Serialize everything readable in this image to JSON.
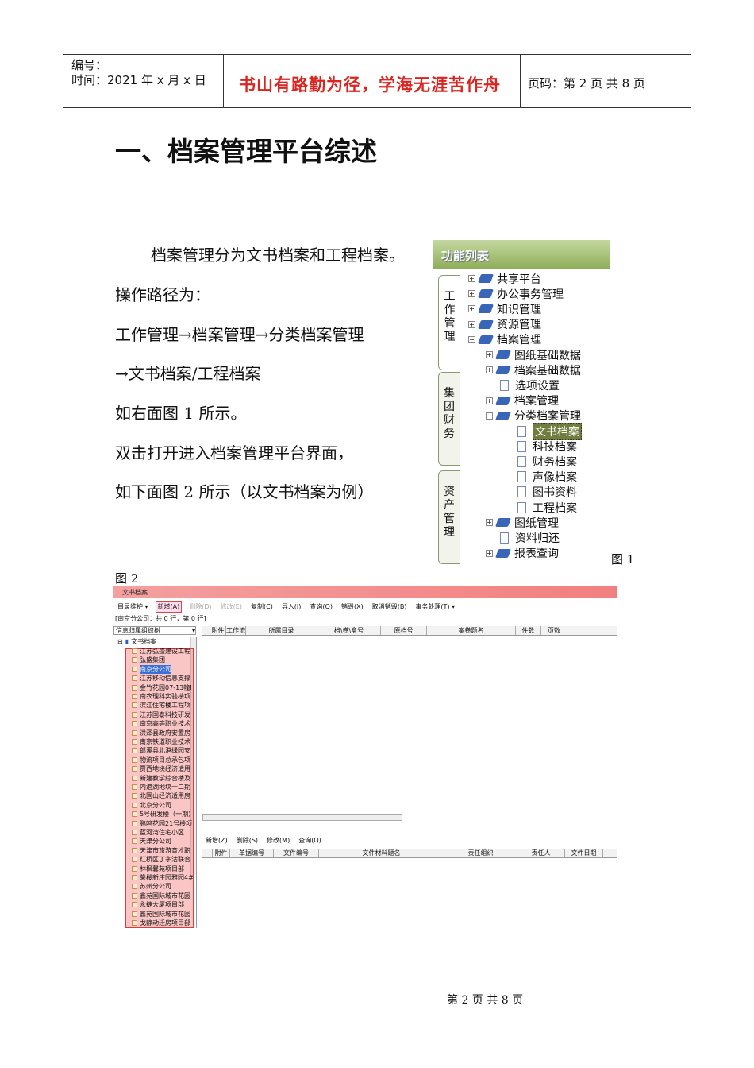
{
  "header": {
    "number_label": "编号：",
    "time_label": "时间：2021 年 x 月 x 日",
    "motto": "书山有路勤为径，学海无涯苦作舟",
    "page_label": "页码：第 2 页  共 8 页"
  },
  "title": "一、档案管理平台综述",
  "body": [
    "档案管理分为文书档案和工程档案。",
    "操作路径为：",
    "工作管理→档案管理→分类档案管理",
    "→文书档案/工程档案",
    "如右面图 1 所示。",
    "双击打开进入档案管理平台界面，",
    "如下面图 2 所示（以文书档案为例）"
  ],
  "fig1": {
    "caption": "图 1",
    "panel_title": "功能列表",
    "tabs": [
      "工作管理",
      "集团财务",
      "资产管理"
    ],
    "tree": [
      {
        "label": "共享平台",
        "level": 0,
        "type": "book",
        "exp": "+"
      },
      {
        "label": "办公事务管理",
        "level": 0,
        "type": "book",
        "exp": "+"
      },
      {
        "label": "知识管理",
        "level": 0,
        "type": "book",
        "exp": "+"
      },
      {
        "label": "资源管理",
        "level": 0,
        "type": "book",
        "exp": "+"
      },
      {
        "label": "档案管理",
        "level": 0,
        "type": "book",
        "exp": "−"
      },
      {
        "label": "图纸基础数据",
        "level": 1,
        "type": "book",
        "exp": "+"
      },
      {
        "label": "档案基础数据",
        "level": 1,
        "type": "book",
        "exp": "+"
      },
      {
        "label": "选项设置",
        "level": 1,
        "type": "doc",
        "exp": ""
      },
      {
        "label": "档案管理",
        "level": 1,
        "type": "book",
        "exp": "+"
      },
      {
        "label": "分类档案管理",
        "level": 1,
        "type": "book",
        "exp": "−"
      },
      {
        "label": "文书档案",
        "level": 2,
        "type": "doc",
        "exp": "",
        "selected": true
      },
      {
        "label": "科技档案",
        "level": 2,
        "type": "doc",
        "exp": ""
      },
      {
        "label": "财务档案",
        "level": 2,
        "type": "doc",
        "exp": ""
      },
      {
        "label": "声像档案",
        "level": 2,
        "type": "doc",
        "exp": ""
      },
      {
        "label": "图书资料",
        "level": 2,
        "type": "doc",
        "exp": ""
      },
      {
        "label": "工程档案",
        "level": 2,
        "type": "doc",
        "exp": ""
      },
      {
        "label": "图纸管理",
        "level": 1,
        "type": "book",
        "exp": "+"
      },
      {
        "label": "资料归还",
        "level": 1,
        "type": "doc",
        "exp": ""
      },
      {
        "label": "报表查询",
        "level": 1,
        "type": "book",
        "exp": "+"
      }
    ]
  },
  "fig2": {
    "caption": "图 2",
    "window_title": "文书档案",
    "toolbar": [
      {
        "label": "目录维护 ▾",
        "state": "normal"
      },
      {
        "label": "新增(A)",
        "state": "active"
      },
      {
        "label": "删除(D)",
        "state": "disabled"
      },
      {
        "label": "修改(E)",
        "state": "disabled"
      },
      {
        "label": "复制(C)",
        "state": "normal"
      },
      {
        "label": "导入(I)",
        "state": "normal"
      },
      {
        "label": "查询(Q)",
        "state": "normal"
      },
      {
        "label": "销毁(X)",
        "state": "normal"
      },
      {
        "label": "取消销毁(B)",
        "state": "normal"
      },
      {
        "label": "事务处理(T) ▾",
        "state": "normal"
      }
    ],
    "status": "[南京分公司：共 0 行，第 0 行]",
    "tree_combo": "信息归属组织树",
    "tree_root": "文书档案",
    "tree_items": [
      "江苏弘盛建设工程",
      "弘盛集团",
      "南京分公司",
      "江苏移动信息支撑",
      "金竹花园07-13幢I",
      "南农理科实验楼项",
      "滨江住宅楼工程项",
      "江苏国泰科技研发",
      "南京高等职业技术",
      "洪泽县政府安置房",
      "南京铁道职业技术",
      "郎溪县北港绿园安",
      "物流项目总承包项",
      "贾西地块经济适用",
      "新建教学综合楼及",
      "内港湖地块一二期",
      "北固山经济适用房",
      "北京分公司",
      "5号研发楼（一期）",
      "鹏鸣花园21号楼项",
      "蓝河湾住宅小区二",
      "天津分公司",
      "天津市旅游育才职",
      "红桥区丁字沽联合",
      "林枫馨苑项目部",
      "柴楼新庄园雅园4#",
      "苏州分公司",
      "鑫苑国际城市花园",
      "永捷大厦项目部",
      "鑫苑国际城市花园",
      "戈静动迁房项目部"
    ],
    "selected_tree_item": 2,
    "upper_columns": [
      "",
      "附件",
      "工作流",
      "所属目录",
      "档\\卷\\盒号",
      "原档号",
      "案卷题名",
      "件数",
      "页数"
    ],
    "lower_toolbar": [
      "新增(Z)",
      "删除(S)",
      "修改(M)",
      "查询(Q)"
    ],
    "lower_columns": [
      "",
      "附件",
      "单据编号",
      "文件编号",
      "文件材料题名",
      "责任组织",
      "责任人",
      "文件日期"
    ]
  },
  "footer": "第 2 页 共 8 页"
}
